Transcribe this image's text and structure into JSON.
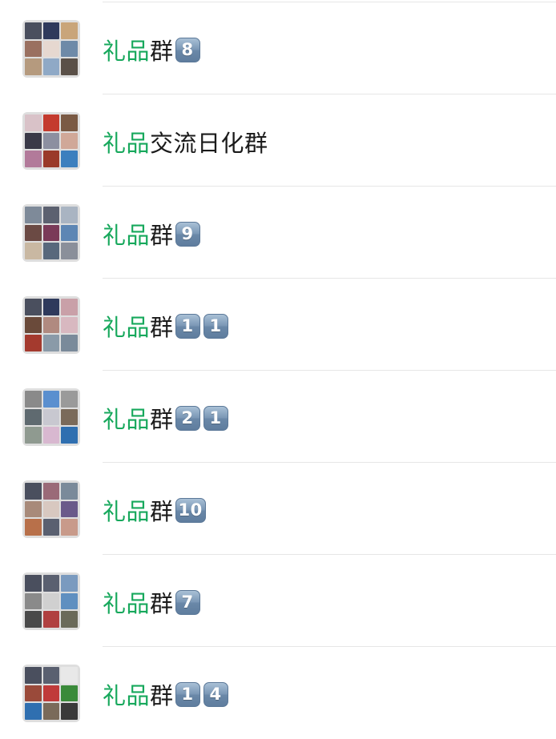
{
  "highlight_color": "#17a85c",
  "text_color": "#1b1b1b",
  "groups": [
    {
      "name_highlight": "礼品",
      "name_rest": "群",
      "badges": [
        "8"
      ],
      "avatar_tiles": [
        "#4a4f5e",
        "#2f3a5c",
        "#c9a57a",
        "#9a7060",
        "#e6d8d0",
        "#6e8aa8",
        "#b59a7e",
        "#8fa9c6",
        "#5a5048"
      ]
    },
    {
      "name_highlight": "礼品",
      "name_rest": "交流日化群",
      "badges": [],
      "avatar_tiles": [
        "#d9c2c8",
        "#c43a2e",
        "#7a5a44",
        "#3a3a48",
        "#8c8fa0",
        "#d0a898",
        "#b27a9a",
        "#9a3a2a",
        "#3c7fbe"
      ]
    },
    {
      "name_highlight": "礼品",
      "name_rest": "群",
      "badges": [
        "9"
      ],
      "avatar_tiles": [
        "#7e8a99",
        "#5c6170",
        "#a9b4c2",
        "#6b4a44",
        "#7a3a58",
        "#5d86b4",
        "#c9b8a2",
        "#58687c",
        "#8a8f9a"
      ]
    },
    {
      "name_highlight": "礼品",
      "name_rest": "群",
      "badges": [
        "1",
        "1"
      ],
      "avatar_tiles": [
        "#4a4f5e",
        "#2f3a5c",
        "#c9a0a8",
        "#6a4a3a",
        "#b08a80",
        "#d8b8c0",
        "#a43a2e",
        "#8a9aa8",
        "#7a8a9a"
      ]
    },
    {
      "name_highlight": "礼品",
      "name_rest": "群",
      "badges": [
        "2",
        "1"
      ],
      "avatar_tiles": [
        "#8a8a8a",
        "#5a8fcf",
        "#9a9a9a",
        "#5f6a70",
        "#c8c8d0",
        "#7a6a5a",
        "#8f9a90",
        "#d8b8d0",
        "#2f6fb0"
      ]
    },
    {
      "name_highlight": "礼品",
      "name_rest": "群",
      "badges": [
        "10"
      ],
      "avatar_tiles": [
        "#4a4f5e",
        "#9a6a78",
        "#7a8a9a",
        "#a88a7a",
        "#d8c8c0",
        "#6a5a8a",
        "#b8704a",
        "#5a6070",
        "#c89a8a"
      ]
    },
    {
      "name_highlight": "礼品",
      "name_rest": "群",
      "badges": [
        "7"
      ],
      "avatar_tiles": [
        "#4a4f5e",
        "#5a6070",
        "#7a9abf",
        "#8a8a8a",
        "#d0d0d0",
        "#5f8fc0",
        "#4a4a4a",
        "#b04040",
        "#6a6a5a"
      ]
    },
    {
      "name_highlight": "礼品",
      "name_rest": "群",
      "badges": [
        "1",
        "4"
      ],
      "avatar_tiles": [
        "#4a4f5e",
        "#5a6070",
        "#e8e8e8",
        "#9a4a3a",
        "#c03a3a",
        "#3a8a3a",
        "#2f6fb0",
        "#7a6a5a",
        "#3a3a3a"
      ]
    }
  ]
}
